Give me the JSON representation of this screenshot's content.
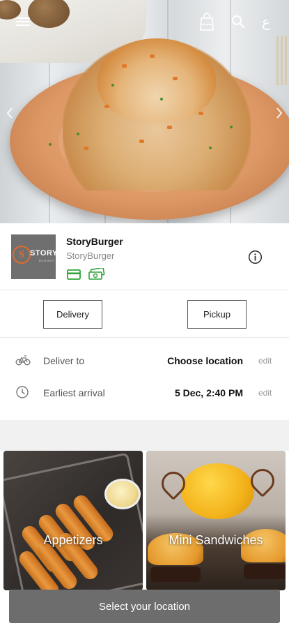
{
  "header": {
    "menu_icon": "hamburger-menu-icon",
    "bag_icon": "shopping-bag-icon",
    "search_icon": "search-icon",
    "language_toggle": "ع"
  },
  "hero": {
    "image": "pasta-dish-photo",
    "prev_icon": "chevron-left-icon",
    "next_icon": "chevron-right-icon"
  },
  "restaurant": {
    "name": "StoryBurger",
    "subtitle": "StoryBurger",
    "logo": {
      "monogram": "S",
      "text": "STORY",
      "subtext": "BURGER"
    },
    "payment_icons": [
      "credit-card-icon",
      "cash-icon"
    ],
    "accent_color": "#2fa33a",
    "info_icon": "info-icon"
  },
  "order_type": {
    "delivery_label": "Delivery",
    "pickup_label": "Pickup"
  },
  "delivery": {
    "deliver_to_label": "Deliver to",
    "deliver_to_value": "Choose location",
    "deliver_to_edit": "edit",
    "arrival_label": "Earliest arrival",
    "arrival_value": "5 Dec, 2:40 PM",
    "arrival_edit": "edit"
  },
  "categories": [
    {
      "label": "Appetizers"
    },
    {
      "label": "Mini Sandwiches"
    }
  ],
  "footer": {
    "select_location_label": "Select your location",
    "button_color": "#6d6d6d"
  }
}
